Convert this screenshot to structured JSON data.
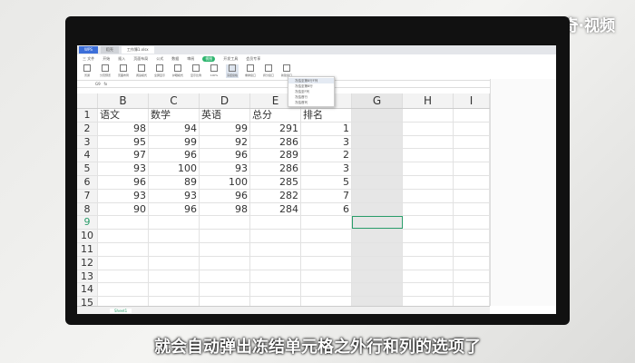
{
  "watermark": "天奇·视频",
  "subtitle": "就会自动弹出冻结单元格之外行和列的选项了",
  "titlebar": {
    "tabs": [
      "WPS",
      "稻壳",
      "工作簿1.xlsx"
    ]
  },
  "menubar": [
    "三 文件",
    "开始",
    "插入",
    "页面布局",
    "公式",
    "数据",
    "审阅",
    "视图",
    "开发工具",
    "会员专享"
  ],
  "active_menu": "视图",
  "ribbon": [
    "普通",
    "分页预览",
    "页面布局",
    "阅读模式",
    "全屏显示",
    "护眼模式",
    "显示比例",
    "100%",
    "冻结窗格",
    "重排窗口",
    "拆分窗口",
    "新建窗口"
  ],
  "freeze_menu": [
    "冻结至第8行F列",
    "冻结至第8行",
    "冻结至F列",
    "冻结首行",
    "冻结首列"
  ],
  "formula_bar": {
    "name_box": "G9",
    "fx": "fx"
  },
  "columns": [
    "",
    "B",
    "C",
    "D",
    "E",
    "F",
    "G",
    "H",
    "I"
  ],
  "rows": [
    [
      "1",
      "语文",
      "数学",
      "英语",
      "总分",
      "排名",
      "",
      "",
      ""
    ],
    [
      "2",
      "98",
      "94",
      "99",
      "291",
      "1",
      "",
      "",
      ""
    ],
    [
      "3",
      "95",
      "99",
      "92",
      "286",
      "3",
      "",
      "",
      ""
    ],
    [
      "4",
      "97",
      "96",
      "96",
      "289",
      "2",
      "",
      "",
      ""
    ],
    [
      "5",
      "93",
      "100",
      "93",
      "286",
      "3",
      "",
      "",
      ""
    ],
    [
      "6",
      "96",
      "89",
      "100",
      "285",
      "5",
      "",
      "",
      ""
    ],
    [
      "7",
      "93",
      "93",
      "96",
      "282",
      "7",
      "",
      "",
      ""
    ],
    [
      "8",
      "90",
      "96",
      "98",
      "284",
      "6",
      "",
      "",
      ""
    ],
    [
      "9",
      "",
      "",
      "",
      "",
      "",
      "",
      "",
      ""
    ],
    [
      "10",
      "",
      "",
      "",
      "",
      "",
      "",
      "",
      ""
    ],
    [
      "11",
      "",
      "",
      "",
      "",
      "",
      "",
      "",
      ""
    ],
    [
      "12",
      "",
      "",
      "",
      "",
      "",
      "",
      "",
      ""
    ],
    [
      "13",
      "",
      "",
      "",
      "",
      "",
      "",
      "",
      ""
    ],
    [
      "14",
      "",
      "",
      "",
      "",
      "",
      "",
      "",
      ""
    ],
    [
      "15",
      "",
      "",
      "",
      "",
      "",
      "",
      "",
      ""
    ]
  ],
  "sheet_tab": "Sheet1",
  "colors": {
    "accent": "#2a9d6a",
    "home_tab": "#3d6fd9"
  }
}
